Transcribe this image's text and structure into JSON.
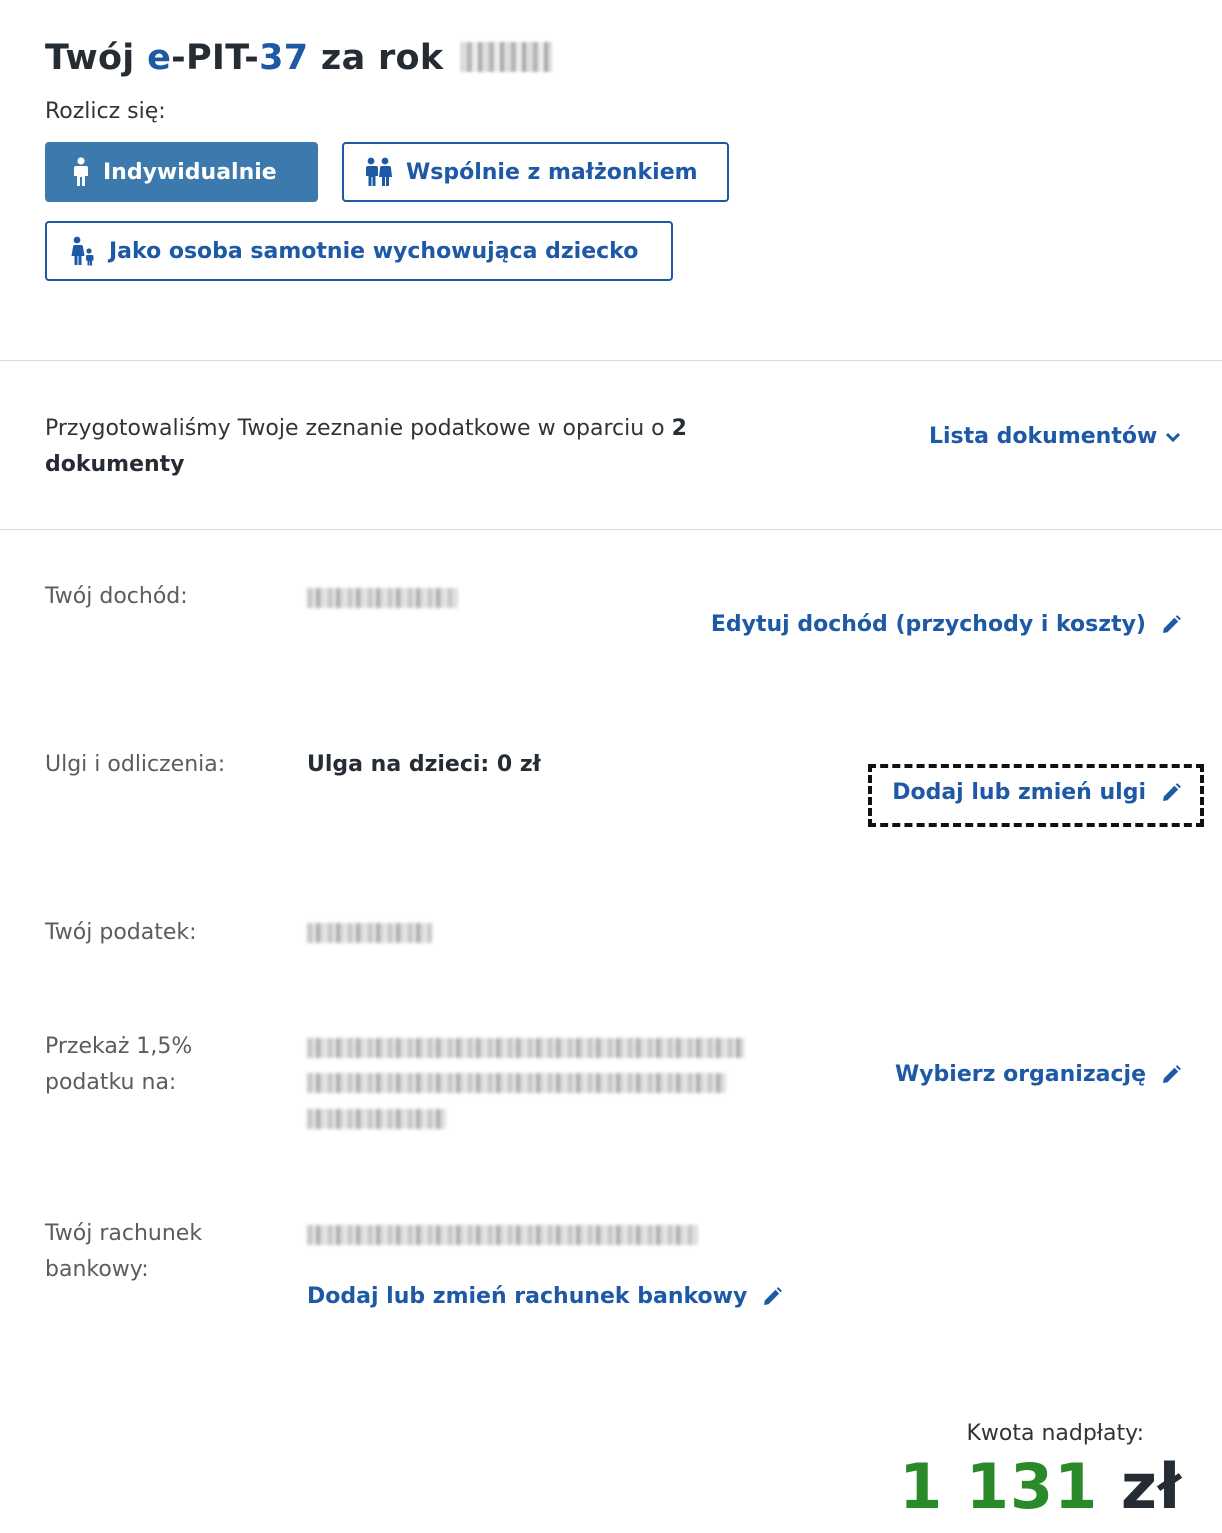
{
  "header": {
    "title_prefix": "Twój ",
    "title_blue_1": "e",
    "title_dash": "-PIT-",
    "title_blue_2": "37",
    "title_suffix": " za rok",
    "subtitle": "Rozlicz się:"
  },
  "options": {
    "individual": "Indywidualnie",
    "joint": "Wspólnie z małżonkiem",
    "single_parent": "Jako osoba samotnie wychowująca dziecko",
    "selected": "individual"
  },
  "documents": {
    "text_before": "Przygotowaliśmy Twoje zeznanie podatkowe w oparciu o ",
    "count": "2",
    "text_after": "dokumenty",
    "list_link": "Lista dokumentów"
  },
  "rows": {
    "income": {
      "label": "Twój dochód:",
      "link": "Edytuj dochód (przychody i koszty)"
    },
    "reliefs": {
      "label": "Ulgi i odliczenia:",
      "value": "Ulga na dzieci: 0 zł",
      "link": "Dodaj lub zmień ulgi"
    },
    "tax": {
      "label": "Twój podatek:"
    },
    "donation": {
      "label": "Przekaż 1,5% podatku na:",
      "link": "Wybierz organizację"
    },
    "bank": {
      "label": "Twój rachunek bankowy:",
      "link": "Dodaj lub zmień rachunek bankowy"
    }
  },
  "refund": {
    "label": "Kwota nadpłaty:",
    "amount": "1 131",
    "currency": "zł"
  },
  "colors": {
    "primary": "#1e59a6",
    "primary_button": "#3c79ad",
    "refund_green": "#2a8a2a"
  },
  "icons": {
    "individual": "person-icon",
    "joint": "couple-icon",
    "single_parent": "parent-child-icon",
    "edit": "pencil-icon",
    "dropdown": "chevron-down-icon"
  }
}
